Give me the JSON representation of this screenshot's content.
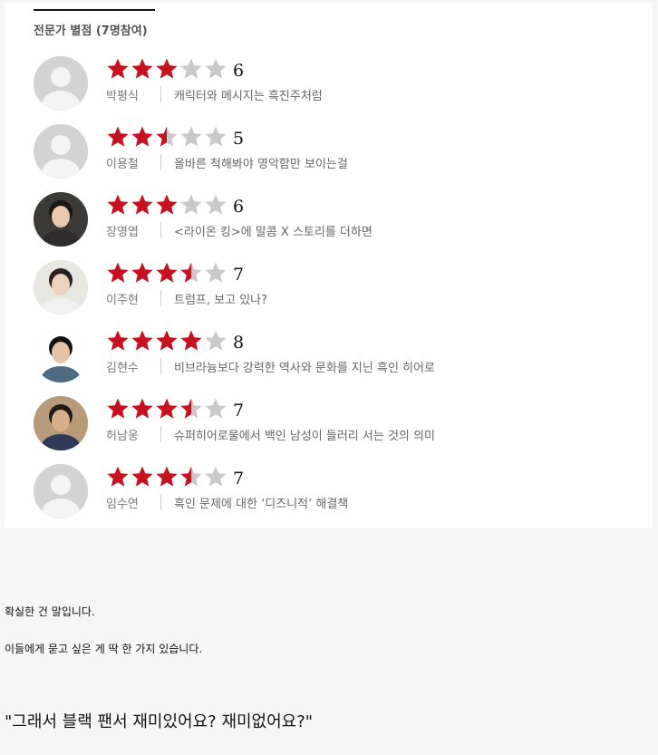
{
  "expert_section": {
    "title": "전문가 별점 (7명참여)",
    "star_max": 5,
    "colors": {
      "star_filled": "#c8101e",
      "star_empty": "#c9c9c9"
    },
    "reviews": [
      {
        "name": "박평식",
        "score": "6",
        "stars": 3,
        "comment": "캐릭터와 메시지는 흑진주처럼",
        "avatar": "placeholder"
      },
      {
        "name": "이용철",
        "score": "5",
        "stars": 2.5,
        "comment": "올바른 척해봐야 영악함만 보이는걸",
        "avatar": "placeholder"
      },
      {
        "name": "장영엽",
        "score": "6",
        "stars": 3,
        "comment": "<라이온 킹>에 말콤 X 스토리를 더하면",
        "avatar": "photo"
      },
      {
        "name": "이주현",
        "score": "7",
        "stars": 3.5,
        "comment": "트럼프, 보고 있나?",
        "avatar": "photo"
      },
      {
        "name": "김현수",
        "score": "8",
        "stars": 4,
        "comment": "비브라늄보다 강력한 역사와 문화를 지닌 흑인 히어로",
        "avatar": "photo"
      },
      {
        "name": "허남웅",
        "score": "7",
        "stars": 3.5,
        "comment": "슈퍼히어로물에서 백인 남성이 들러리 서는 것의 의미",
        "avatar": "photo"
      },
      {
        "name": "임수연",
        "score": "7",
        "stars": 3.5,
        "comment": "흑인 문제에 대한 ‘디즈니적’ 해결책",
        "avatar": "placeholder"
      }
    ]
  },
  "article": {
    "para1": "확실한 건 말입니다.",
    "para2": "이들에게 묻고 싶은 게 딱 한 가지 있습니다.",
    "quote": "\"그래서 블랙 팬서 재미있어요? 재미없어요?\""
  }
}
